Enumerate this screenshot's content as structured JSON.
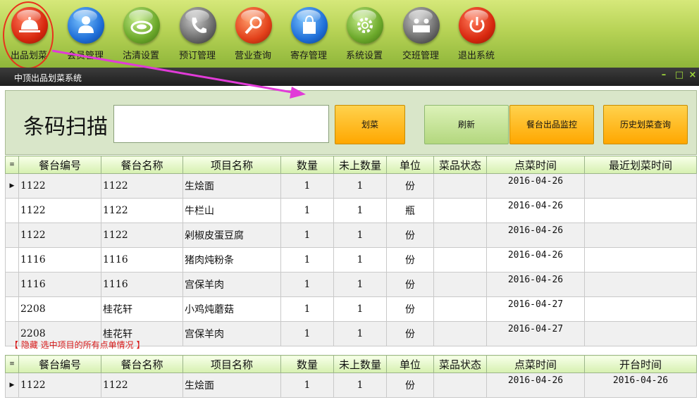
{
  "toolbar": {
    "items": [
      {
        "label": "出品划菜",
        "icon": "cloche-icon"
      },
      {
        "label": "会员管理",
        "icon": "person-icon"
      },
      {
        "label": "沽清设置",
        "icon": "plate-icon"
      },
      {
        "label": "预订管理",
        "icon": "phone-icon"
      },
      {
        "label": "营业查询",
        "icon": "magnifier-icon"
      },
      {
        "label": "寄存管理",
        "icon": "bag-icon"
      },
      {
        "label": "系统设置",
        "icon": "gear-icon"
      },
      {
        "label": "交班管理",
        "icon": "handover-icon"
      },
      {
        "label": "退出系统",
        "icon": "power-icon"
      }
    ]
  },
  "window": {
    "title": "中顶出品划菜系统",
    "controls": {
      "minimize": "–",
      "maximize": "□",
      "close": "×"
    }
  },
  "scan": {
    "label": "条码扫描",
    "input_value": "",
    "buttons": {
      "mark": "划菜",
      "refresh": "刷新",
      "monitor": "餐台出品监控",
      "history": "历史划菜查询"
    }
  },
  "main_table": {
    "columns": [
      "餐台编号",
      "餐台名称",
      "项目名称",
      "数量",
      "未上数量",
      "单位",
      "菜品状态",
      "点菜时间",
      "最近划菜时间"
    ],
    "rows": [
      [
        "1122",
        "1122",
        "生烩面",
        "1",
        "1",
        "份",
        "",
        "2016-04-26",
        ""
      ],
      [
        "1122",
        "1122",
        "牛栏山",
        "1",
        "1",
        "瓶",
        "",
        "2016-04-26",
        ""
      ],
      [
        "1122",
        "1122",
        "剁椒皮蛋豆腐",
        "1",
        "1",
        "份",
        "",
        "2016-04-26",
        ""
      ],
      [
        "1116",
        "1116",
        "猪肉炖粉条",
        "1",
        "1",
        "份",
        "",
        "2016-04-26",
        ""
      ],
      [
        "1116",
        "1116",
        "宫保羊肉",
        "1",
        "1",
        "份",
        "",
        "2016-04-26",
        ""
      ],
      [
        "2208",
        "桂花轩",
        "小鸡炖蘑菇",
        "1",
        "1",
        "份",
        "",
        "2016-04-27",
        ""
      ],
      [
        "2208",
        "桂花轩",
        "宫保羊肉",
        "1",
        "1",
        "份",
        "",
        "2016-04-27",
        ""
      ]
    ]
  },
  "detail_hint": "【 隐藏 选中项目的所有点单情况 】",
  "detail_table": {
    "columns": [
      "餐台编号",
      "餐台名称",
      "项目名称",
      "数量",
      "未上数量",
      "单位",
      "菜品状态",
      "点菜时间",
      "开台时间"
    ],
    "rows": [
      [
        "1122",
        "1122",
        "生烩面",
        "1",
        "1",
        "份",
        "",
        "2016-04-26",
        "2016-04-26"
      ]
    ]
  },
  "colors": {
    "accent": "#ffa700",
    "annotation": "#e13bd8",
    "circle": "#e8321c"
  }
}
